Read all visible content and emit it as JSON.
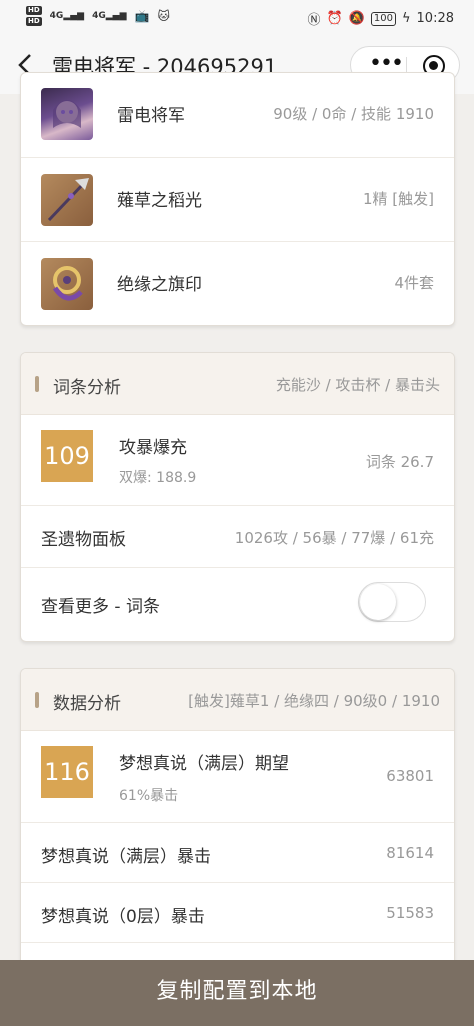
{
  "statusbar": {
    "hd1": "HD",
    "hd2": "HD",
    "net1": "4G",
    "net2": "4G",
    "battery": "100",
    "time": "10:28"
  },
  "titlebar": {
    "back_icon": "chevron-left-icon",
    "title": "雷电将军 - 204695291",
    "more_icon": "more-dots-icon",
    "close_icon": "target-circle-icon"
  },
  "equipment": [
    {
      "name": "雷电将军",
      "info": "90级 / 0命 / 技能 1910",
      "icon": "character-portrait"
    },
    {
      "name": "薙草之稻光",
      "info": "1精 [触发]",
      "icon": "polearm-weapon-icon"
    },
    {
      "name": "绝缘之旗印",
      "info": "4件套",
      "icon": "artifact-set-icon"
    }
  ],
  "substat": {
    "title": "词条分析",
    "subtitle": "充能沙 / 攻击杯 / 暴击头",
    "score": {
      "value": "109",
      "title": "攻暴爆充",
      "sub": "双爆: 188.9",
      "right": "词条 26.7"
    },
    "rows": [
      {
        "label": "圣遗物面板",
        "value": "1026攻 / 56暴 / 77爆 / 61充"
      },
      {
        "label": "查看更多 - 词条",
        "toggle": false
      }
    ]
  },
  "damage": {
    "title": "数据分析",
    "subtitle": "[触发]薙草1 / 绝缘四 / 90级0 / 1910",
    "score": {
      "value": "116",
      "title": "梦想真说（满层）期望",
      "sub": "61%暴击",
      "right": "63801"
    },
    "rows": [
      {
        "label": "梦想真说（满层）暴击",
        "value": "81614"
      },
      {
        "label": "梦想真说（0层）暴击",
        "value": "51583"
      }
    ]
  },
  "bottom_button": "复制配置到本地",
  "colors": {
    "accent": "#d9a553",
    "bottom_button": "#7b6f63",
    "section_header": "#f6f2ed"
  }
}
